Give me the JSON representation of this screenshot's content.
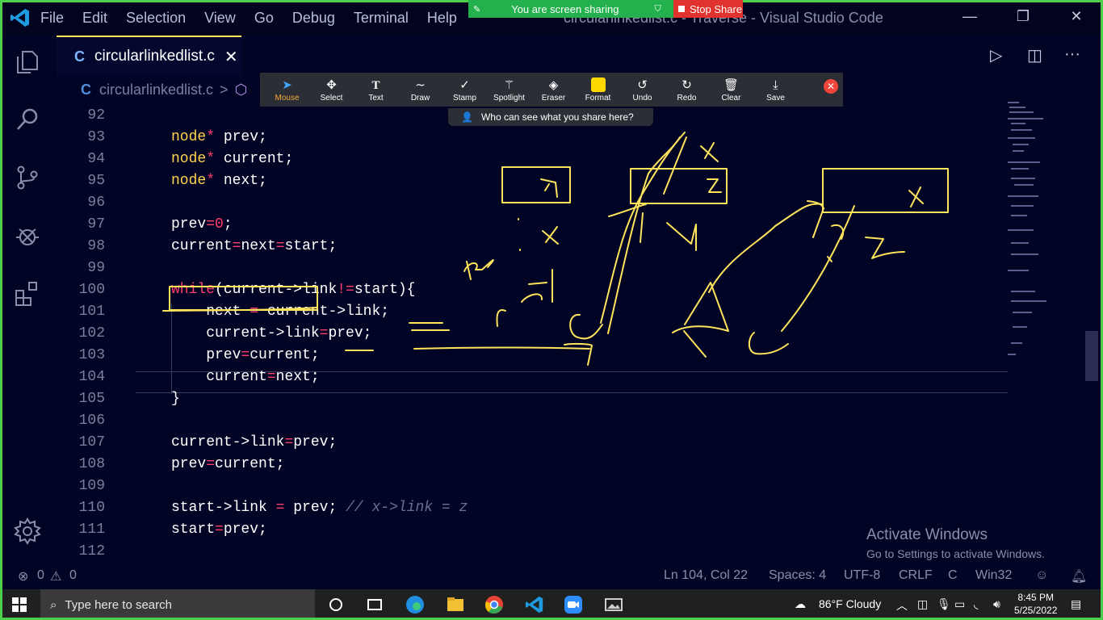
{
  "share_banner": {
    "text": "You are screen sharing",
    "stop_label": "Stop Share"
  },
  "menu": [
    "File",
    "Edit",
    "Selection",
    "View",
    "Go",
    "Debug",
    "Terminal",
    "Help"
  ],
  "window_title": "circularlinkedlist.c - Traverse - Visual Studio Code",
  "tab": {
    "name": "circularlinkedlist.c",
    "close": "✕"
  },
  "breadcrumb": {
    "file": "circularlinkedlist.c",
    "sep": ">"
  },
  "zoom_toolbar": {
    "tools": [
      "Mouse",
      "Select",
      "Text",
      "Draw",
      "Stamp",
      "Spotlight",
      "Eraser",
      "Format",
      "Undo",
      "Redo",
      "Clear",
      "Save"
    ],
    "who_can_see": "Who can see what you share here?"
  },
  "code_lines": [
    {
      "n": "92"
    },
    {
      "n": "93",
      "t": "node",
      "s": "*",
      "r": " prev;"
    },
    {
      "n": "94",
      "t": "node",
      "s": "*",
      "r": " current;"
    },
    {
      "n": "95",
      "t": "node",
      "s": "*",
      "r": " next;"
    },
    {
      "n": "96"
    },
    {
      "n": "97",
      "a": "prev",
      "op": "=",
      "v": "0",
      "e": ";"
    },
    {
      "n": "98",
      "a": "current",
      "op": "=",
      "b": "next",
      "op2": "=",
      "e": "start;"
    },
    {
      "n": "99"
    },
    {
      "n": "100",
      "w": "while",
      "x": "(current->link",
      "op": "!=",
      "y": "start){"
    },
    {
      "n": "101",
      "a": "    next ",
      "op": "=",
      "e": " current->link;"
    },
    {
      "n": "102",
      "a": "    current->link",
      "op": "=",
      "e": "prev;"
    },
    {
      "n": "103",
      "a": "    prev",
      "op": "=",
      "e": "current;"
    },
    {
      "n": "104",
      "a": "    current",
      "op": "=",
      "e": "next;"
    },
    {
      "n": "105",
      "p": "}"
    },
    {
      "n": "106"
    },
    {
      "n": "107",
      "a": "current->link",
      "op": "=",
      "e": "prev;"
    },
    {
      "n": "108",
      "a": "prev",
      "op": "=",
      "e": "current;"
    },
    {
      "n": "109"
    },
    {
      "n": "110",
      "a": "start->link ",
      "op": "=",
      "e": " prev; ",
      "c": "// x->link = z"
    },
    {
      "n": "111",
      "a": "start",
      "op": "=",
      "e": "prev;"
    },
    {
      "n": "112"
    }
  ],
  "activate": {
    "title": "Activate Windows",
    "sub": "Go to Settings to activate Windows."
  },
  "status": {
    "errors": "0",
    "warnings": "0",
    "position": "Ln 104, Col 22",
    "spaces": "Spaces: 4",
    "encoding": "UTF-8",
    "eol": "CRLF",
    "lang": "C",
    "platform": "Win32"
  },
  "taskbar": {
    "search_placeholder": "Type here to search",
    "weather": "86°F  Cloudy",
    "time": "8:45 PM",
    "date": "5/25/2022"
  },
  "icons": [
    "vscode-logo-icon",
    "explorer-icon",
    "search-icon",
    "source-control-icon",
    "debug-icon",
    "extensions-icon",
    "settings-gear-icon",
    "run-icon",
    "split-editor-icon",
    "more-icon"
  ]
}
